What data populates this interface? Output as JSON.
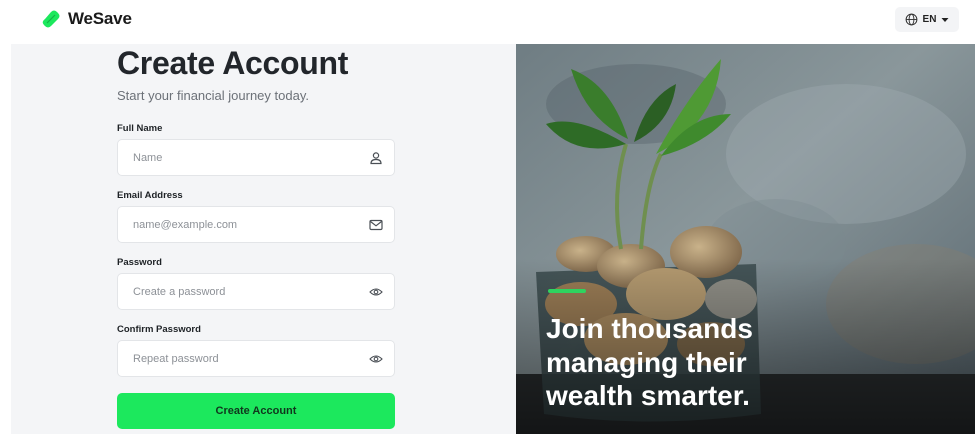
{
  "brand": {
    "name": "WeSave",
    "color": "#1ce85d"
  },
  "header": {
    "language": "EN",
    "language_icon": "globe-icon",
    "dropdown_icon": "caret-down-icon"
  },
  "form": {
    "title": "Create Account",
    "subtitle": "Start your financial journey today.",
    "fields": [
      {
        "label": "Full Name",
        "placeholder": "Name",
        "icon": "user-icon"
      },
      {
        "label": "Email Address",
        "placeholder": "name@example.com",
        "icon": "mail-icon"
      },
      {
        "label": "Password",
        "placeholder": "Create a password",
        "icon": "eye-icon"
      },
      {
        "label": "Confirm Password",
        "placeholder": "Repeat password",
        "icon": "eye-icon"
      }
    ],
    "submit_label": "Create Account"
  },
  "hero": {
    "line1": "Join thousands",
    "line2": "managing their",
    "line3": "wealth smarter.",
    "accent_color": "#2fd35f"
  }
}
